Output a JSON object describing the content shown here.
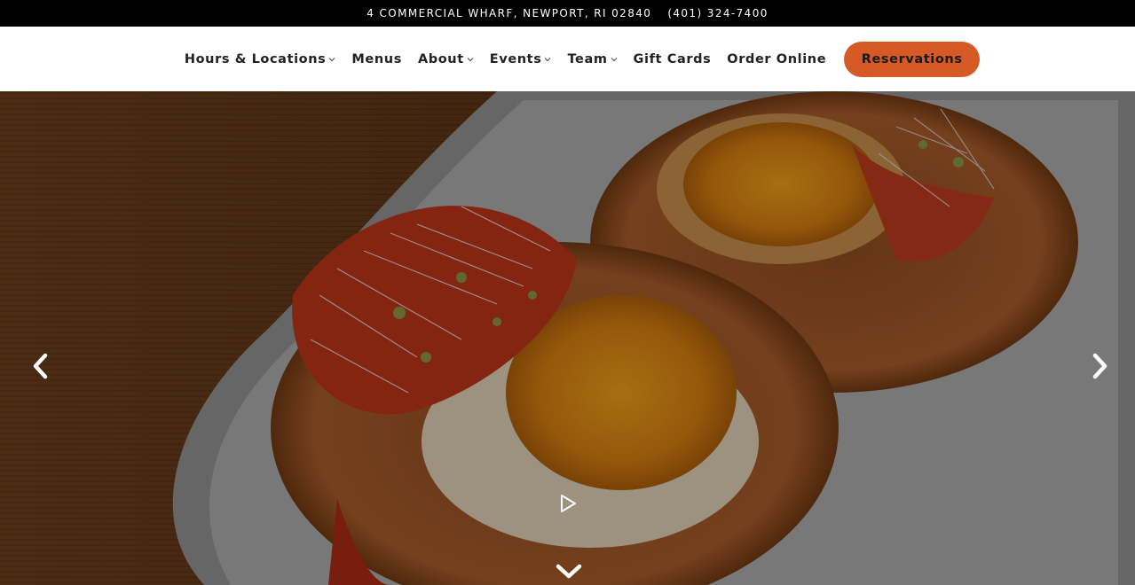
{
  "topbar": {
    "address": "4 COMMERCIAL WHARF, NEWPORT, RI 02840",
    "phone": "(401) 324-7400"
  },
  "nav": {
    "items": [
      {
        "label": "Hours & Locations",
        "has_dropdown": true
      },
      {
        "label": "Menus",
        "has_dropdown": false
      },
      {
        "label": "About",
        "has_dropdown": true
      },
      {
        "label": "Events",
        "has_dropdown": true
      },
      {
        "label": "Team",
        "has_dropdown": true
      },
      {
        "label": "Gift Cards",
        "has_dropdown": false
      },
      {
        "label": "Order Online",
        "has_dropdown": false
      }
    ],
    "reservations_label": "Reservations"
  },
  "hero": {
    "icons": {
      "prev": "chevron-left-icon",
      "next": "chevron-right-icon",
      "play": "play-icon",
      "scroll": "chevron-down-icon"
    }
  },
  "colors": {
    "accent": "#d55a26",
    "topbar_bg": "#000000",
    "nav_bg": "#ffffff",
    "nav_text": "#222222"
  }
}
